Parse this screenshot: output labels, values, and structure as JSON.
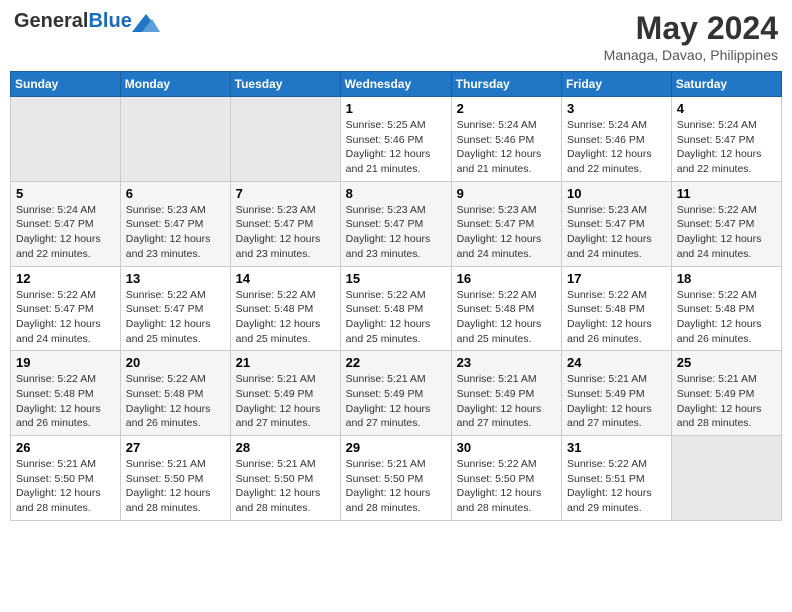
{
  "header": {
    "logo_general": "General",
    "logo_blue": "Blue",
    "month_title": "May 2024",
    "location": "Managa, Davao, Philippines"
  },
  "weekdays": [
    "Sunday",
    "Monday",
    "Tuesday",
    "Wednesday",
    "Thursday",
    "Friday",
    "Saturday"
  ],
  "weeks": [
    [
      {
        "day": "",
        "info": ""
      },
      {
        "day": "",
        "info": ""
      },
      {
        "day": "",
        "info": ""
      },
      {
        "day": "1",
        "info": "Sunrise: 5:25 AM\nSunset: 5:46 PM\nDaylight: 12 hours\nand 21 minutes."
      },
      {
        "day": "2",
        "info": "Sunrise: 5:24 AM\nSunset: 5:46 PM\nDaylight: 12 hours\nand 21 minutes."
      },
      {
        "day": "3",
        "info": "Sunrise: 5:24 AM\nSunset: 5:46 PM\nDaylight: 12 hours\nand 22 minutes."
      },
      {
        "day": "4",
        "info": "Sunrise: 5:24 AM\nSunset: 5:47 PM\nDaylight: 12 hours\nand 22 minutes."
      }
    ],
    [
      {
        "day": "5",
        "info": "Sunrise: 5:24 AM\nSunset: 5:47 PM\nDaylight: 12 hours\nand 22 minutes."
      },
      {
        "day": "6",
        "info": "Sunrise: 5:23 AM\nSunset: 5:47 PM\nDaylight: 12 hours\nand 23 minutes."
      },
      {
        "day": "7",
        "info": "Sunrise: 5:23 AM\nSunset: 5:47 PM\nDaylight: 12 hours\nand 23 minutes."
      },
      {
        "day": "8",
        "info": "Sunrise: 5:23 AM\nSunset: 5:47 PM\nDaylight: 12 hours\nand 23 minutes."
      },
      {
        "day": "9",
        "info": "Sunrise: 5:23 AM\nSunset: 5:47 PM\nDaylight: 12 hours\nand 24 minutes."
      },
      {
        "day": "10",
        "info": "Sunrise: 5:23 AM\nSunset: 5:47 PM\nDaylight: 12 hours\nand 24 minutes."
      },
      {
        "day": "11",
        "info": "Sunrise: 5:22 AM\nSunset: 5:47 PM\nDaylight: 12 hours\nand 24 minutes."
      }
    ],
    [
      {
        "day": "12",
        "info": "Sunrise: 5:22 AM\nSunset: 5:47 PM\nDaylight: 12 hours\nand 24 minutes."
      },
      {
        "day": "13",
        "info": "Sunrise: 5:22 AM\nSunset: 5:47 PM\nDaylight: 12 hours\nand 25 minutes."
      },
      {
        "day": "14",
        "info": "Sunrise: 5:22 AM\nSunset: 5:48 PM\nDaylight: 12 hours\nand 25 minutes."
      },
      {
        "day": "15",
        "info": "Sunrise: 5:22 AM\nSunset: 5:48 PM\nDaylight: 12 hours\nand 25 minutes."
      },
      {
        "day": "16",
        "info": "Sunrise: 5:22 AM\nSunset: 5:48 PM\nDaylight: 12 hours\nand 25 minutes."
      },
      {
        "day": "17",
        "info": "Sunrise: 5:22 AM\nSunset: 5:48 PM\nDaylight: 12 hours\nand 26 minutes."
      },
      {
        "day": "18",
        "info": "Sunrise: 5:22 AM\nSunset: 5:48 PM\nDaylight: 12 hours\nand 26 minutes."
      }
    ],
    [
      {
        "day": "19",
        "info": "Sunrise: 5:22 AM\nSunset: 5:48 PM\nDaylight: 12 hours\nand 26 minutes."
      },
      {
        "day": "20",
        "info": "Sunrise: 5:22 AM\nSunset: 5:48 PM\nDaylight: 12 hours\nand 26 minutes."
      },
      {
        "day": "21",
        "info": "Sunrise: 5:21 AM\nSunset: 5:49 PM\nDaylight: 12 hours\nand 27 minutes."
      },
      {
        "day": "22",
        "info": "Sunrise: 5:21 AM\nSunset: 5:49 PM\nDaylight: 12 hours\nand 27 minutes."
      },
      {
        "day": "23",
        "info": "Sunrise: 5:21 AM\nSunset: 5:49 PM\nDaylight: 12 hours\nand 27 minutes."
      },
      {
        "day": "24",
        "info": "Sunrise: 5:21 AM\nSunset: 5:49 PM\nDaylight: 12 hours\nand 27 minutes."
      },
      {
        "day": "25",
        "info": "Sunrise: 5:21 AM\nSunset: 5:49 PM\nDaylight: 12 hours\nand 28 minutes."
      }
    ],
    [
      {
        "day": "26",
        "info": "Sunrise: 5:21 AM\nSunset: 5:50 PM\nDaylight: 12 hours\nand 28 minutes."
      },
      {
        "day": "27",
        "info": "Sunrise: 5:21 AM\nSunset: 5:50 PM\nDaylight: 12 hours\nand 28 minutes."
      },
      {
        "day": "28",
        "info": "Sunrise: 5:21 AM\nSunset: 5:50 PM\nDaylight: 12 hours\nand 28 minutes."
      },
      {
        "day": "29",
        "info": "Sunrise: 5:21 AM\nSunset: 5:50 PM\nDaylight: 12 hours\nand 28 minutes."
      },
      {
        "day": "30",
        "info": "Sunrise: 5:22 AM\nSunset: 5:50 PM\nDaylight: 12 hours\nand 28 minutes."
      },
      {
        "day": "31",
        "info": "Sunrise: 5:22 AM\nSunset: 5:51 PM\nDaylight: 12 hours\nand 29 minutes."
      },
      {
        "day": "",
        "info": ""
      }
    ]
  ]
}
